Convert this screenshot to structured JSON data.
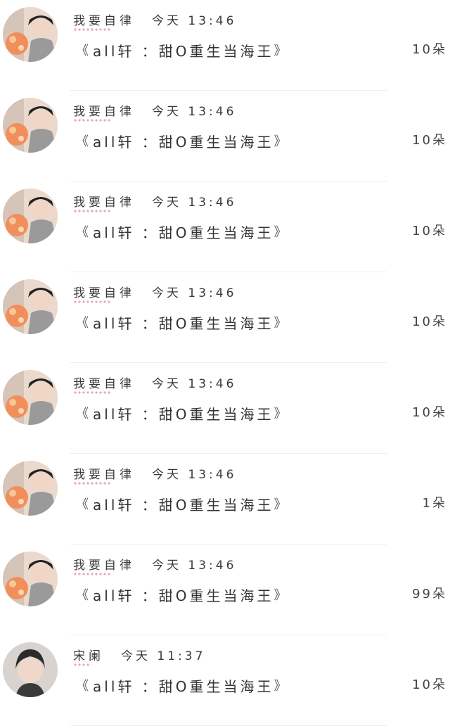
{
  "rows": [
    {
      "user": "我要自律",
      "time": "今天 13:46",
      "bracket_open": "《",
      "title": "all轩 ：甜O重生当海王",
      "bracket_close": "》",
      "count": "10朵",
      "avatar": "user-photo-a"
    },
    {
      "user": "我要自律",
      "time": "今天 13:46",
      "bracket_open": "《",
      "title": "all轩 ：甜O重生当海王",
      "bracket_close": "》",
      "count": "10朵",
      "avatar": "user-photo-a"
    },
    {
      "user": "我要自律",
      "time": "今天 13:46",
      "bracket_open": "《",
      "title": "all轩 ：甜O重生当海王",
      "bracket_close": "》",
      "count": "10朵",
      "avatar": "user-photo-a"
    },
    {
      "user": "我要自律",
      "time": "今天 13:46",
      "bracket_open": "《",
      "title": "all轩 ：甜O重生当海王",
      "bracket_close": "》",
      "count": "10朵",
      "avatar": "user-photo-a"
    },
    {
      "user": "我要自律",
      "time": "今天 13:46",
      "bracket_open": "《",
      "title": "all轩 ：甜O重生当海王",
      "bracket_close": "》",
      "count": "10朵",
      "avatar": "user-photo-a"
    },
    {
      "user": "我要自律",
      "time": "今天 13:46",
      "bracket_open": "《",
      "title": "all轩 ：甜O重生当海王",
      "bracket_close": "》",
      "count": "1朵",
      "avatar": "user-photo-a"
    },
    {
      "user": "我要自律",
      "time": "今天 13:46",
      "bracket_open": "《",
      "title": "all轩 ：甜O重生当海王",
      "bracket_close": "》",
      "count": "99朵",
      "avatar": "user-photo-a"
    },
    {
      "user": "宋阑",
      "time": "今天 11:37",
      "bracket_open": "《",
      "title": "all轩 ：甜O重生当海王",
      "bracket_close": "》",
      "count": "10朵",
      "avatar": "user-photo-b"
    }
  ],
  "colors": {
    "text": "#333333",
    "divider": "#eeeeee",
    "accent_pink": "#f2a3c6",
    "accent_yellow": "#f3d96b"
  }
}
